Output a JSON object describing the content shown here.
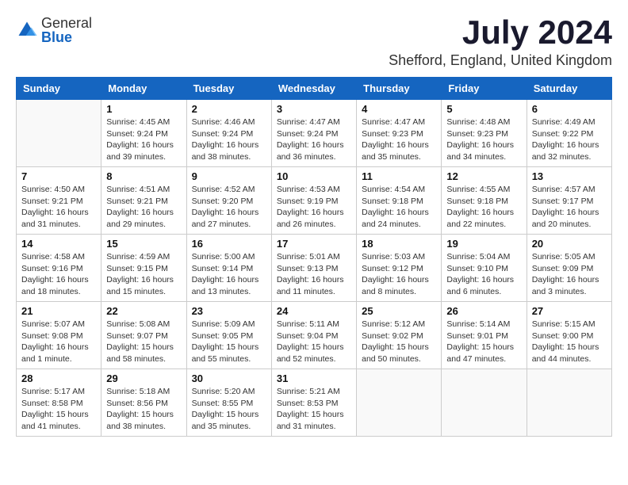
{
  "header": {
    "logo_general": "General",
    "logo_blue": "Blue",
    "month": "July 2024",
    "location": "Shefford, England, United Kingdom"
  },
  "weekdays": [
    "Sunday",
    "Monday",
    "Tuesday",
    "Wednesday",
    "Thursday",
    "Friday",
    "Saturday"
  ],
  "weeks": [
    [
      {
        "day": "",
        "info": ""
      },
      {
        "day": "1",
        "info": "Sunrise: 4:45 AM\nSunset: 9:24 PM\nDaylight: 16 hours\nand 39 minutes."
      },
      {
        "day": "2",
        "info": "Sunrise: 4:46 AM\nSunset: 9:24 PM\nDaylight: 16 hours\nand 38 minutes."
      },
      {
        "day": "3",
        "info": "Sunrise: 4:47 AM\nSunset: 9:24 PM\nDaylight: 16 hours\nand 36 minutes."
      },
      {
        "day": "4",
        "info": "Sunrise: 4:47 AM\nSunset: 9:23 PM\nDaylight: 16 hours\nand 35 minutes."
      },
      {
        "day": "5",
        "info": "Sunrise: 4:48 AM\nSunset: 9:23 PM\nDaylight: 16 hours\nand 34 minutes."
      },
      {
        "day": "6",
        "info": "Sunrise: 4:49 AM\nSunset: 9:22 PM\nDaylight: 16 hours\nand 32 minutes."
      }
    ],
    [
      {
        "day": "7",
        "info": "Sunrise: 4:50 AM\nSunset: 9:21 PM\nDaylight: 16 hours\nand 31 minutes."
      },
      {
        "day": "8",
        "info": "Sunrise: 4:51 AM\nSunset: 9:21 PM\nDaylight: 16 hours\nand 29 minutes."
      },
      {
        "day": "9",
        "info": "Sunrise: 4:52 AM\nSunset: 9:20 PM\nDaylight: 16 hours\nand 27 minutes."
      },
      {
        "day": "10",
        "info": "Sunrise: 4:53 AM\nSunset: 9:19 PM\nDaylight: 16 hours\nand 26 minutes."
      },
      {
        "day": "11",
        "info": "Sunrise: 4:54 AM\nSunset: 9:18 PM\nDaylight: 16 hours\nand 24 minutes."
      },
      {
        "day": "12",
        "info": "Sunrise: 4:55 AM\nSunset: 9:18 PM\nDaylight: 16 hours\nand 22 minutes."
      },
      {
        "day": "13",
        "info": "Sunrise: 4:57 AM\nSunset: 9:17 PM\nDaylight: 16 hours\nand 20 minutes."
      }
    ],
    [
      {
        "day": "14",
        "info": "Sunrise: 4:58 AM\nSunset: 9:16 PM\nDaylight: 16 hours\nand 18 minutes."
      },
      {
        "day": "15",
        "info": "Sunrise: 4:59 AM\nSunset: 9:15 PM\nDaylight: 16 hours\nand 15 minutes."
      },
      {
        "day": "16",
        "info": "Sunrise: 5:00 AM\nSunset: 9:14 PM\nDaylight: 16 hours\nand 13 minutes."
      },
      {
        "day": "17",
        "info": "Sunrise: 5:01 AM\nSunset: 9:13 PM\nDaylight: 16 hours\nand 11 minutes."
      },
      {
        "day": "18",
        "info": "Sunrise: 5:03 AM\nSunset: 9:12 PM\nDaylight: 16 hours\nand 8 minutes."
      },
      {
        "day": "19",
        "info": "Sunrise: 5:04 AM\nSunset: 9:10 PM\nDaylight: 16 hours\nand 6 minutes."
      },
      {
        "day": "20",
        "info": "Sunrise: 5:05 AM\nSunset: 9:09 PM\nDaylight: 16 hours\nand 3 minutes."
      }
    ],
    [
      {
        "day": "21",
        "info": "Sunrise: 5:07 AM\nSunset: 9:08 PM\nDaylight: 16 hours\nand 1 minute."
      },
      {
        "day": "22",
        "info": "Sunrise: 5:08 AM\nSunset: 9:07 PM\nDaylight: 15 hours\nand 58 minutes."
      },
      {
        "day": "23",
        "info": "Sunrise: 5:09 AM\nSunset: 9:05 PM\nDaylight: 15 hours\nand 55 minutes."
      },
      {
        "day": "24",
        "info": "Sunrise: 5:11 AM\nSunset: 9:04 PM\nDaylight: 15 hours\nand 52 minutes."
      },
      {
        "day": "25",
        "info": "Sunrise: 5:12 AM\nSunset: 9:02 PM\nDaylight: 15 hours\nand 50 minutes."
      },
      {
        "day": "26",
        "info": "Sunrise: 5:14 AM\nSunset: 9:01 PM\nDaylight: 15 hours\nand 47 minutes."
      },
      {
        "day": "27",
        "info": "Sunrise: 5:15 AM\nSunset: 9:00 PM\nDaylight: 15 hours\nand 44 minutes."
      }
    ],
    [
      {
        "day": "28",
        "info": "Sunrise: 5:17 AM\nSunset: 8:58 PM\nDaylight: 15 hours\nand 41 minutes."
      },
      {
        "day": "29",
        "info": "Sunrise: 5:18 AM\nSunset: 8:56 PM\nDaylight: 15 hours\nand 38 minutes."
      },
      {
        "day": "30",
        "info": "Sunrise: 5:20 AM\nSunset: 8:55 PM\nDaylight: 15 hours\nand 35 minutes."
      },
      {
        "day": "31",
        "info": "Sunrise: 5:21 AM\nSunset: 8:53 PM\nDaylight: 15 hours\nand 31 minutes."
      },
      {
        "day": "",
        "info": ""
      },
      {
        "day": "",
        "info": ""
      },
      {
        "day": "",
        "info": ""
      }
    ]
  ]
}
